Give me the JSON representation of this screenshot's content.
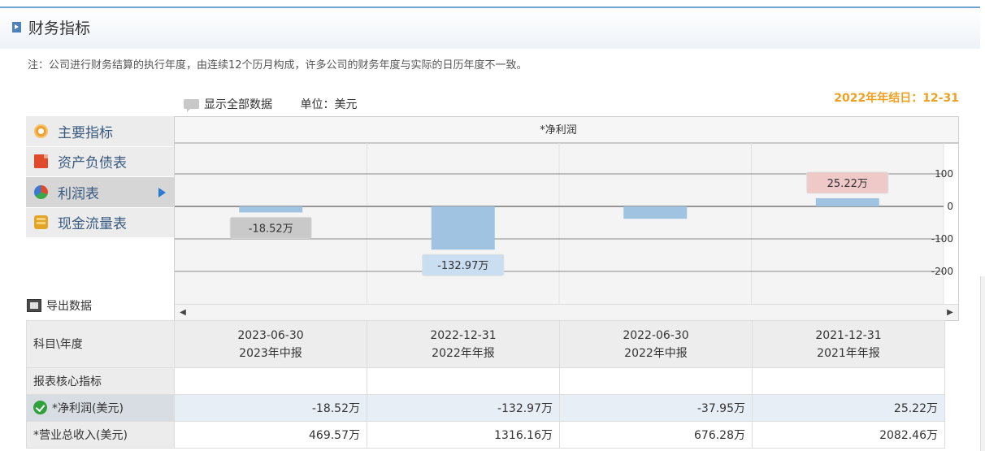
{
  "header": {
    "title": "财务指标"
  },
  "note": "注：公司进行财务结算的执行年度，由连续12个历月构成，许多公司的财务年度与实际的日历年度不一致。",
  "year_end": "2022年年结日：12-31",
  "toolbar": {
    "show_all": "显示全部数据",
    "unit": "单位：美元"
  },
  "sidebar": {
    "items": [
      {
        "label": "主要指标",
        "icon": "gear-icon"
      },
      {
        "label": "资产负债表",
        "icon": "document-icon"
      },
      {
        "label": "利润表",
        "icon": "pie-chart-icon",
        "active": true
      },
      {
        "label": "现金流量表",
        "icon": "coins-icon"
      }
    ]
  },
  "export_label": "导出数据",
  "chart_data": {
    "type": "bar",
    "title": "*净利润",
    "categories": [
      "2023-06-30",
      "2022-12-31",
      "2022-06-30",
      "2021-12-31"
    ],
    "values": [
      -18.52,
      -132.97,
      -37.95,
      25.22
    ],
    "value_labels": [
      "-18.52万",
      "-132.97万",
      "",
      "25.22万"
    ],
    "yticks": [
      100,
      0,
      -100,
      -200
    ],
    "ytick_labels": [
      "100",
      "0",
      "-100",
      "-200"
    ],
    "ylim": [
      -300,
      200
    ],
    "grid": true,
    "bar_color": "#9fc3e0",
    "label_colors": [
      "#c9c9c9",
      "#c9def0",
      "",
      "#efc8c8"
    ]
  },
  "table": {
    "header_label": "科目\\年度",
    "columns": [
      {
        "date": "2023-06-30",
        "period": "2023年中报"
      },
      {
        "date": "2022-12-31",
        "period": "2022年年报"
      },
      {
        "date": "2022-06-30",
        "period": "2022年中报"
      },
      {
        "date": "2021-12-31",
        "period": "2021年年报"
      }
    ],
    "section": "报表核心指标",
    "rows": [
      {
        "label": "*净利润(美元)",
        "values": [
          "-18.52万",
          "-132.97万",
          "-37.95万",
          "25.22万"
        ],
        "checked": true
      },
      {
        "label": "*营业总收入(美元)",
        "values": [
          "469.57万",
          "1316.16万",
          "676.28万",
          "2082.46万"
        ]
      }
    ]
  }
}
